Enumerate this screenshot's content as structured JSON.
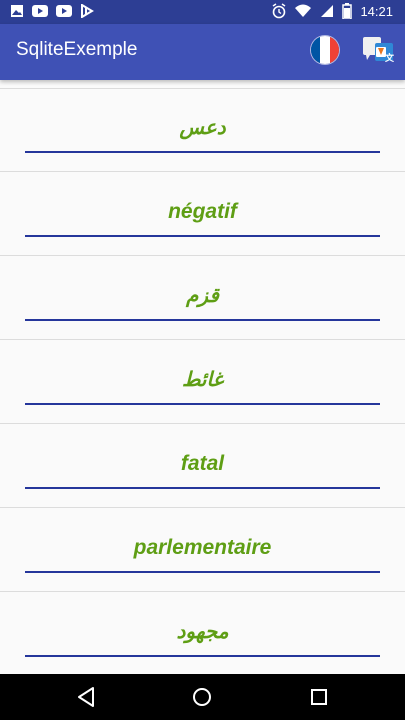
{
  "status_bar": {
    "time": "14:21",
    "left_icons": [
      "image-icon",
      "youtube-icon",
      "youtube-icon",
      "download-icon"
    ],
    "right_icons": [
      "alarm-icon",
      "wifi-icon",
      "sim-icon",
      "battery-icon"
    ]
  },
  "app_bar": {
    "title": "SqliteExemple",
    "actions": [
      "french-flag-icon",
      "translate-icon"
    ]
  },
  "colors": {
    "app_bar": "#3f51b5",
    "status_bar": "#2d3e94",
    "word_text": "#5e9e14",
    "underline": "#25369b"
  },
  "words": [
    {
      "text": "دعس",
      "lang": "ar"
    },
    {
      "text": "négatif",
      "lang": "fr"
    },
    {
      "text": "قزم",
      "lang": "ar"
    },
    {
      "text": "غائط",
      "lang": "ar"
    },
    {
      "text": "fatal",
      "lang": "fr"
    },
    {
      "text": "parlementaire",
      "lang": "fr"
    },
    {
      "text": "مجهود",
      "lang": "ar"
    }
  ],
  "nav_bar": {
    "buttons": [
      "back-icon",
      "home-icon",
      "recents-icon"
    ]
  }
}
